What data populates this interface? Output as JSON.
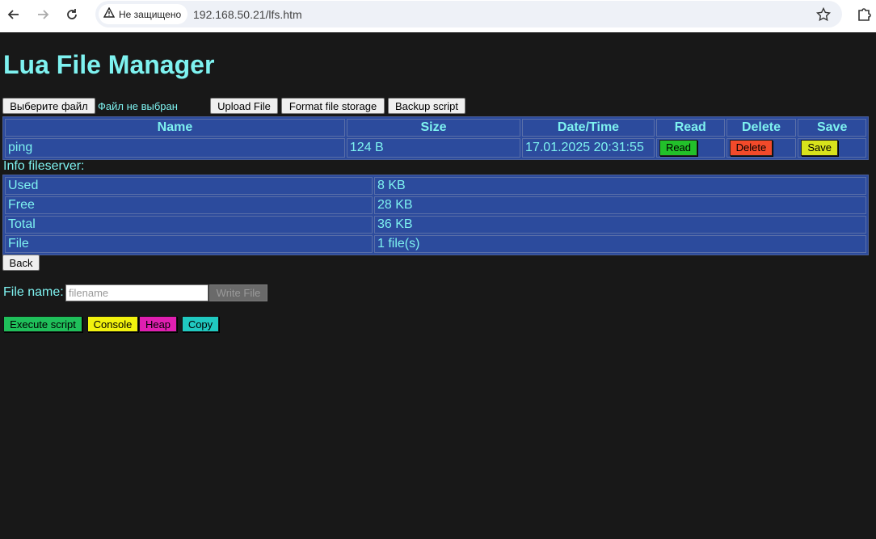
{
  "browser": {
    "security_label": "Не защищено",
    "url": "192.168.50.21/lfs.htm"
  },
  "page": {
    "title": "Lua File Manager",
    "choose_file_label": "Выберите файл",
    "no_file_label": "Файл не выбран",
    "upload_label": "Upload File",
    "format_label": "Format file storage",
    "backup_label": "Backup script"
  },
  "files_table": {
    "headers": [
      "Name",
      "Size",
      "Date/Time",
      "Read",
      "Delete",
      "Save"
    ],
    "rows": [
      {
        "name": "ping",
        "size": "124 B",
        "datetime": "17.01.2025 20:31:55",
        "read": "Read",
        "delete": "Delete",
        "save": "Save"
      }
    ]
  },
  "info": {
    "label": "Info fileserver:",
    "rows": [
      {
        "key": "Used",
        "value": "8 KB"
      },
      {
        "key": "Free",
        "value": "28 KB"
      },
      {
        "key": "Total",
        "value": "36 KB"
      },
      {
        "key": "File",
        "value": "1 file(s)"
      }
    ]
  },
  "back_label": "Back",
  "write": {
    "label": "File name:",
    "placeholder": "filename",
    "button": "Write File"
  },
  "actions": {
    "execute": "Execute script",
    "console": "Console",
    "heap": "Heap",
    "copy": "Copy"
  },
  "colors": {
    "text": "#7ef2f0",
    "table_bg": "#2c4b9d",
    "read": "#22c02a",
    "delete": "#f24a2a",
    "save": "#d8e21c",
    "execute": "#1fbf5a",
    "console": "#f2f20e",
    "heap": "#e01fb0",
    "copy": "#20c9c0"
  }
}
